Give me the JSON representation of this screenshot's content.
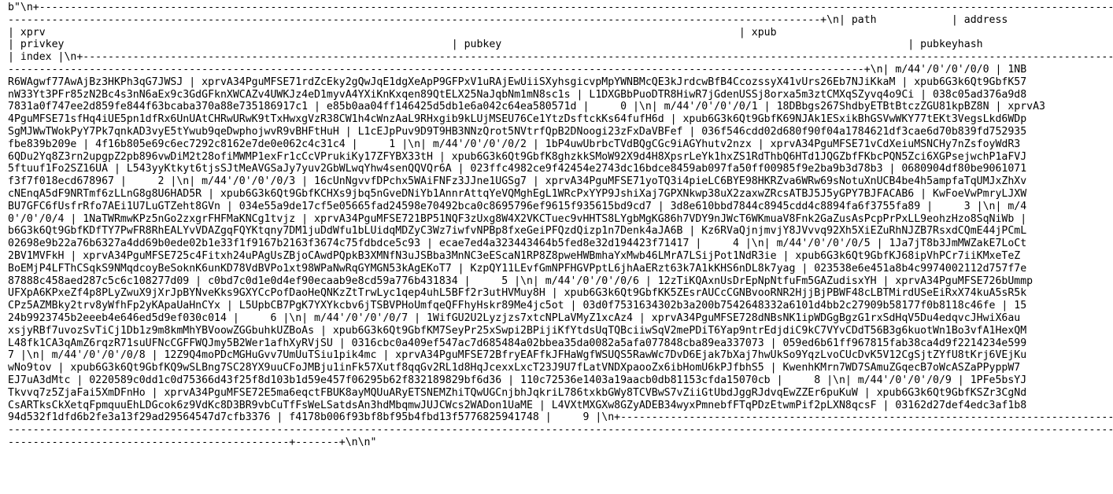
{
  "terminal": {
    "lines": [
      "b\"\\n+-------------------------------------------------------------------------------------------------------------------------------------------------------------------------------------------------------------",
      "----------------------------------------------------------------------------------------------------------------------------------+\\n| path            | address",
      "| xprv                                                                                                               | xpub",
      "| privkey                                                              | pubkey                                                                 | pubkeyhash",
      "| index |\\n+---------------------------------------------------------------------------------------------------------------------------------------------------------------------------------------------------",
      "-----------------------------------------------------------------------------------------------------------------------------------------+\\n| m/44'/0'/0'/0/0 | 1NB",
      "R6WAgwf77AwAjBz3HKPh3qG7JWSJ | xprvA34PguMFSE71rdZcEky2gQwJqE1dgXeApP9GFPxV1uRAjEwUiiSXyhsgicvpMpYWNBMcQE3kJrdcwBfB4CcozssyX41vUrs26Eb7NJiKkaM | xpub6G3k6Qt9GbfK57",
      "nW33Yt3PFr85zN2Bc4s3nN6aEx9c3GdGFknXWCAZv4UWKJz4eD1myvA4YXiKnKxqen89QtELX25NaJqbNm1mN8sc1s | L1DXGBbPuoDTR8HiwR7jGdenUSSj8orxa5m3ztCMXqSZyvq4o9Ci | 038c05ad376a9d8",
      "7831a0f747ee2d859fe844f63bcaba370a88e735186917c1 | e85b0aa04ff146425d5db1e6a042c64ea580571d |     0 |\\n| m/44'/0'/0'/0/1 | 18DBbgs267ShdbyETBtBtczZGU81kpBZ8N | xprvA3",
      "4PguMFSE71sfHq4iUE5pn1dfRx6UnUAtCHRwURwK9tTxHwxgVzR38CW1h4cWnzAaL9RHxgib9kLUjMSEU76Ce1YtzDsftckKs64fufH6d | xpub6G3k6Qt9GbfK69NJAk1ESxikBhGSVwWKY77tEKt3VegsLkd6WDp",
      "SgMJWwTWokPyY7Pk7qnkAD3vyE5tYwub9qeDwphojwvR9vBHFtHuH | L1cEJpPuv9D9T9HB3NNzQrot5NVtrfQpB2DNoogi23zFxDaVBFef | 036f546cdd02d680f90f04a1784621df3cae6d70b839fd752935",
      "fbe839b209e | 4f16b805e69c6ec7292c8162e7de0e062c4c31c4 |     1 |\\n| m/44'/0'/0'/0/2 | 1bP4uwUbrbcTVdBQgCGc9iAGYhutv2nzx | xprvA34PguMFSE71vCdXeiuMSNCHy7nZsfoyWdR3",
      "6QDu2Yq8Z3rn2upgpZ2pb896vwDiM2t28ofiMWMP1exFr1cCcVPrukiKy17ZFYBX33tH | xpub6G3k6Qt9GbfK8ghzkkSMoW92X9d4H8XpsrLeYk1hxZS1RdThbQ6HTd1JQGZbfFKbcPQN5Zci6XGPsejwchP1aFVJ",
      "5ftuuf1Fo2SZ16UA | L543yyKtkyt6tjsSJtMeAVGSaJy7yuv2GbWLwqYhw4senQQVQr6A | 023ffc4982ce9f42454e2743dc16bdce8459ab097fa50ff00985f9e2ba9b3d78b3 | 0680904df80be9061071",
      "f3f7f018ecd678967 |     2 |\\n| m/44'/0'/0'/0/3 | 16cUnNgvvfDPchx5WAiFNFz3JJne1UGSg7 | xprvA34PguMFSE71yoTQ3i4pieLC6BYE98HKRZva6WRw69sNotuXnUCB4be4h5ampfaTqUMJxZhXv",
      "cNEnqA5dF9NRTmf6zLLnG8g8U6HAD5R | xpub6G3k6Qt9GbfKCHXs9jbq5nGveDNiYb1AnnrAttqYeVQMghEgL1WRcPxYYP9JshiXaj7GPXNkwp38uX2zaxwZRcsATBJ5J5yGPY7BJFACAB6 | KwFoeVwPmryLJXW",
      "BU7GFC6fUsfrRfo7AEi1U7LuGTZeht8GVn | 034e55a9de17cf5e05665fad24598e70492bca0c8695796ef9615f935615bd9cd7 | 3d8e610bbd7844c8945cdd4c8894fa6f3755fa89 |     3 |\\n| m/4",
      "0'/0'/0/4 | 1NaTWRmwKPz5nGo2zxgrFHFMaKNCg1tvjz | xprvA34PguMFSE721BP51NQF3zUxg8W4X2VKCTuec9vHHTS8LYgbMgKG86h7VDY9nJWcT6WKmuaV8Fnk2GaZusAsPcpPrPxLL9eohzHzo8SqNiWb | ",
      "b6G3k6Qt9GbfKDfTY7PwFR8RhEALYvVDAZgqFQYKtqny7DM1juDdWfu1bLUidqMDZyC3Wz7iwfvNPBp8fxeGeiPFQzdQizp1n7Denk4aJA6B | Kz6RVaQjnjmvjY8JVvvq92Xh5XiEZuRhNJZB7RsxdCQmE44jPCmL",
      "02698e9b22a76b6327a4dd69b0ede02b1e33f1f9167b2163f3674c75fdbdce5c93 | ecae7ed4a323443464b5fed8e32d194423f71417 |     4 |\\n| m/44'/0'/0'/0/5 | 1Ja7jT8b3JmMWZakE7LoCt",
      "2BV1MVFkH | xprvA34PguMFSE725c4Fitxh24uPAgUsZBjoCAwdPQpkB3XMNfN3uJSBba3MnNC3eEScaN1RP8Z8pweHWBmhaYxMwb46LMrA7LSijPot1NdR3ie | xpub6G3k6Qt9GbfKJ68ipVhPCr7iiKMxeTeZ",
      "BoEMjP4LFThCSqkS9NMqdcoyBeSoknK6unKD78VdBVPo1xt98WPaNwRqGYMGN53kAgEKoT7 | KzpQY11LEvfGmNPFHGVPptL6jhAaERzt63k7A1kKHS6nDL8k7yag | 023538e6e451a8b4c9974002112d757f7e",
      "87888c458aed287c5c6c108277d09 | c0bd7c0d1e0d4ef90ecaab9e8cd59a776b431834 |     5 |\\n| m/44'/0'/0'/0/6 | 12zTiKQAxnUsDrEpNpNtfuFm5GAZudisxYH | xprvA34PguMFSE726bUmmp",
      "UFXpA6KPxeZf4p8PLyZwuX9jXrJpBYNveKks9GXYCcPofDaoHeQNKzZtTrwLyc1qep4uhL5BFf2r3utHVMuy8H | xpub6G3k6Qt9GbfKK5ZEsrAUCcCGNBvooRNR2HjjBjPBWF48cLBTMirdUSeEiRxX74kuA5sR5k",
      "CPz5AZMBky2trv8yWfhFp2yKApaUaHnCYx | L5UpbCB7PgK7YXYkcbv6jTSBVPHoUmfqeQFFhyHskr89Me4jc5ot | 03d0f7531634302b3a200b7542648332a6101d4bb2c27909b58177f0b8118c46fe | 15",
      "24b9923745b2eeeb4e646ed5d9ef030c014 |     6 |\\n| m/44'/0'/0'/0/7 | 1WifGU2U2Lyzjzs7xtcNPLaVMyZ1xcAz4 | xprvA34PguMFSE728dNBsNK1ipWDGgBgzG1rxSdHqV5Du4edqvcJHwiX6au",
      "xsjyRBf7uvozSvTiCj1Db1z9m8kmMhYBVoowZGGbuhkUZBoAs | xpub6G3k6Qt9GbfKM7SeyPr25xSwpi2BPijiKfYtdsUqTQBciiwSqV2mePDiT6Yap9ntrEdjdiC9kC7VYvCDdT56B3g6kuotWn1Bo3vfA1HexQM",
      "L48fk1CA3qAmZ6rqzR71suUFNcCGFFWQJmy5B2Wer1afhXyRVjSU | 0316cbc0a409ef547ac7d685484a02bbea35da0082a5afa077848cba89ea337073 | 059ed6b61ff967815fab38ca4d9f2214234e599",
      "7 |\\n| m/44'/0'/0'/0/8 | 12Z9Q4moPDcMGHuGvv7UmUuTSiu1pik4mc | xprvA34PguMFSE72BfryEAFfkJFHaWgfWSUQS5RawWc7DvD6Ejak7bXaj7hwUkSo9YqzLvoCUcDvK5V12CgSjtZYfU8tKrj6VEjKu",
      "wNo9tov | xpub6G3k6Qt9GbfKQ9wSLBng7SC28YX9uuCFoJMBju1inFk57Xutf8qqGv2RL1d8HqJcexxLxcT23J9U7fLatVNDXpaooZx6ibHomU6kPJfbhS5 | KwenhKMrn7WD7SAmuZGqecB7oWcASZaPPyppW7",
      "EJ7uA3dMtc | 0220589c0dd1c0d75366d43f25f8d103b1d59e457f06295b62f832189829bf6d36 | 110c72536e1403a19aacb0db81153cfda15070cb |     8 |\\n| m/44'/0'/0'/0/9 | 1PFe5bsYJ",
      "Tkvvq7z5ZjaFai5XmDFnHo | xprvA34PguMFSE72E5ma6eqctFBUK8ayMQUuARyETSNEMZhiTQwUGCnjbhJqkriL786txkbGWy8TCVBwS7vZiiGtUbdJggRJdvqEwZZEr6puKuW | xpub6G3k6Qt9GbfKSZr3CgNd",
      "CsARTksCkXetqFpmquuEhLDGcok6z9VdKc8D3BR9vbCuTfFsWeLSatdsAn3hdMbqmwJUJCWcs2WADon1UaME | L4VXtMXGXw8GZyADEB34wyxPmnebfFTqPDzEtwmPif2pLXN8qcsF | 03162d27def4edc3af1b8",
      "94d532f1dfd6b2fe3a13f29ad29564547d7cfb3376 | f4178b006f93bf8bf95b4fbd13f5776825941748 |     9 |\\n+-------------------------------------------------------------------------------------------------------------------------------------------------------",
      "------------------------------------------------------------------------------------------------------------------------------------------------------------------------------------------------------",
      "---------------------------------------------+-------+\\n\\n\""
    ]
  }
}
